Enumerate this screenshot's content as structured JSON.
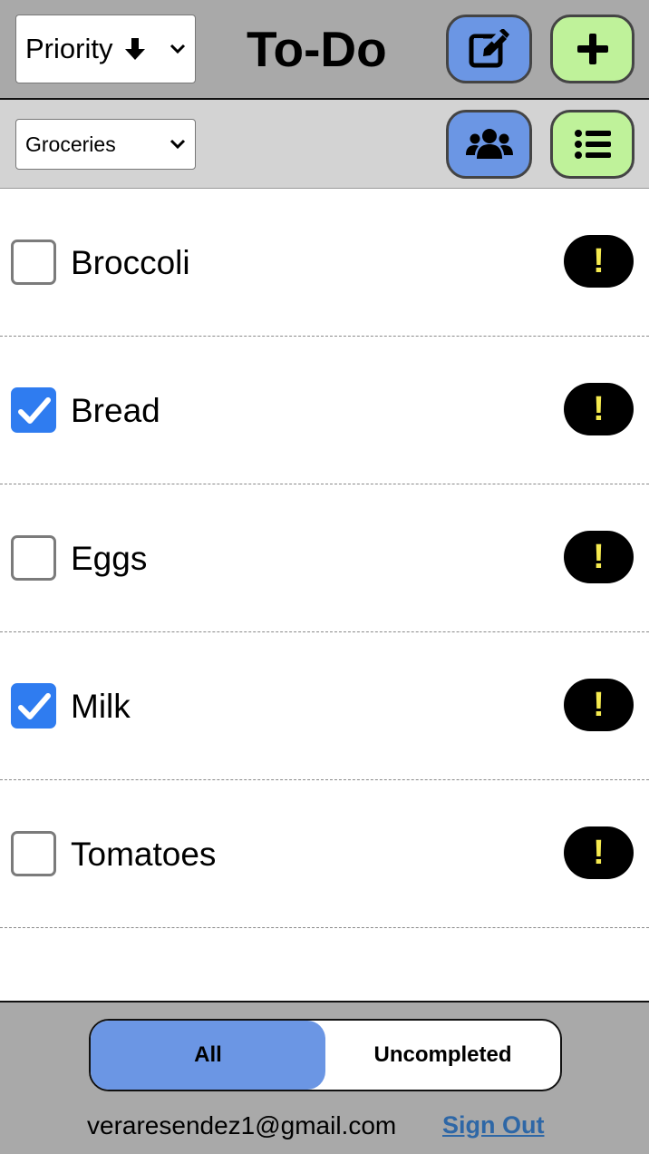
{
  "header": {
    "sort_label": "Priority",
    "title": "To-Do",
    "edit_icon": "edit-icon",
    "add_icon": "plus-icon"
  },
  "subheader": {
    "list_label": "Groceries",
    "share_icon": "users-icon",
    "lists_icon": "list-icon"
  },
  "items": [
    {
      "label": "Broccoli",
      "checked": false,
      "priority": "!"
    },
    {
      "label": "Bread",
      "checked": true,
      "priority": "!"
    },
    {
      "label": "Eggs",
      "checked": false,
      "priority": "!"
    },
    {
      "label": "Milk",
      "checked": true,
      "priority": "!"
    },
    {
      "label": "Tomatoes",
      "checked": false,
      "priority": "!"
    }
  ],
  "footer": {
    "filter_all": "All",
    "filter_uncompleted": "Uncompleted",
    "active_filter": "All",
    "email": "veraresendez1@gmail.com",
    "sign_out": "Sign Out"
  },
  "colors": {
    "header_bg": "#a9a9a9",
    "subheader_bg": "#d3d3d3",
    "button_blue": "#6b96e4",
    "button_green": "#bff29a",
    "checkbox_checked": "#2f7cf0",
    "priority_badge_bg": "#000000",
    "priority_mark": "#f5ea4f",
    "link": "#2e67a6"
  }
}
